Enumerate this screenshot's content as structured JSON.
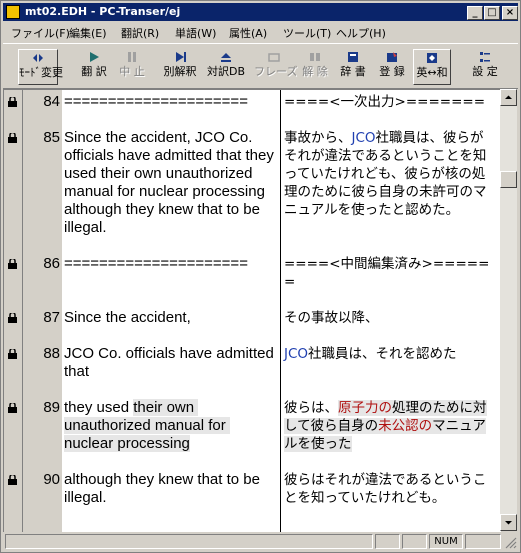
{
  "window": {
    "title": "mt02.EDH - PC-Transer/ej",
    "minimize": "_",
    "maximize": "□",
    "close": "×"
  },
  "menu": [
    {
      "label": "ファイル(F)"
    },
    {
      "label": "編集(E)"
    },
    {
      "label": "翻訳(R)"
    },
    {
      "label": "単語(W)"
    },
    {
      "label": "属性(A)"
    },
    {
      "label": "ツール(T)"
    },
    {
      "label": "ヘルプ(H)"
    }
  ],
  "toolbar": [
    {
      "label": "ﾓｰﾄﾞ変更",
      "icon": "mode-change-icon",
      "enabled": true
    },
    {
      "label": "翻 訳",
      "icon": "play-icon",
      "enabled": true
    },
    {
      "label": "中 止",
      "icon": "pause-icon",
      "enabled": false
    },
    {
      "label": "別解釈",
      "icon": "alt-interpretation-icon",
      "enabled": true
    },
    {
      "label": "対訳DB",
      "icon": "eject-db-icon",
      "enabled": true
    },
    {
      "label": "フレーズ",
      "icon": "phrase-icon",
      "enabled": false
    },
    {
      "label": "解 除",
      "icon": "release-icon",
      "enabled": false
    },
    {
      "label": "辞 書",
      "icon": "dictionary-icon",
      "enabled": true
    },
    {
      "label": "登 録",
      "icon": "register-icon",
      "enabled": true
    },
    {
      "label": "英↔和",
      "icon": "direction-icon",
      "enabled": true
    },
    {
      "label": "設 定",
      "icon": "settings-icon",
      "enabled": true
    }
  ],
  "rows": [
    {
      "num": "84",
      "en": "=====================",
      "jp": [
        {
          "t": "====<一次出力>======="
        }
      ]
    },
    {
      "num": "85",
      "en": "Since the accident, JCO Co. officials have admitted that they used their own unauthorized manual for nuclear processing although they knew that to be illegal.",
      "jp": [
        {
          "t": "事故から、"
        },
        {
          "t": "JCO",
          "c": "blue"
        },
        {
          "t": "社職員は、彼らがそれが違法であるということを知っていたけれども、彼らが核の処理のために彼ら自身の未許可のマニュアルを使ったと認めた。"
        }
      ]
    },
    {
      "num": "86",
      "en": "=====================",
      "jp": [
        {
          "t": "====<中間編集済み>======"
        }
      ]
    },
    {
      "num": "87",
      "en": "Since the accident,",
      "jp": [
        {
          "t": "その事故以降、"
        }
      ]
    },
    {
      "num": "88",
      "en": "JCO Co. officials have admitted that",
      "jp": [
        {
          "t": "JCO",
          "c": "blue"
        },
        {
          "t": "社職員は、それを認めた"
        }
      ]
    },
    {
      "num": "89",
      "en_parts": [
        {
          "t": "they used "
        },
        {
          "t": "their own unauthorized manual for nuclear processing",
          "hl": true
        }
      ],
      "jp": [
        {
          "t": "彼らは、"
        },
        {
          "t": "原子力の",
          "c": "red",
          "hl": true
        },
        {
          "t": "処理のために対して彼ら自身の",
          "hl": true
        },
        {
          "t": "未公認の",
          "c": "red",
          "hl": true
        },
        {
          "t": "マニュアルを使った",
          "hl": true
        }
      ]
    },
    {
      "num": "90",
      "en": "although they knew that to be illegal.",
      "jp": [
        {
          "t": "彼らはそれが違法であるということを知っていたけれども。"
        }
      ]
    }
  ],
  "status": {
    "num": "NUM"
  }
}
